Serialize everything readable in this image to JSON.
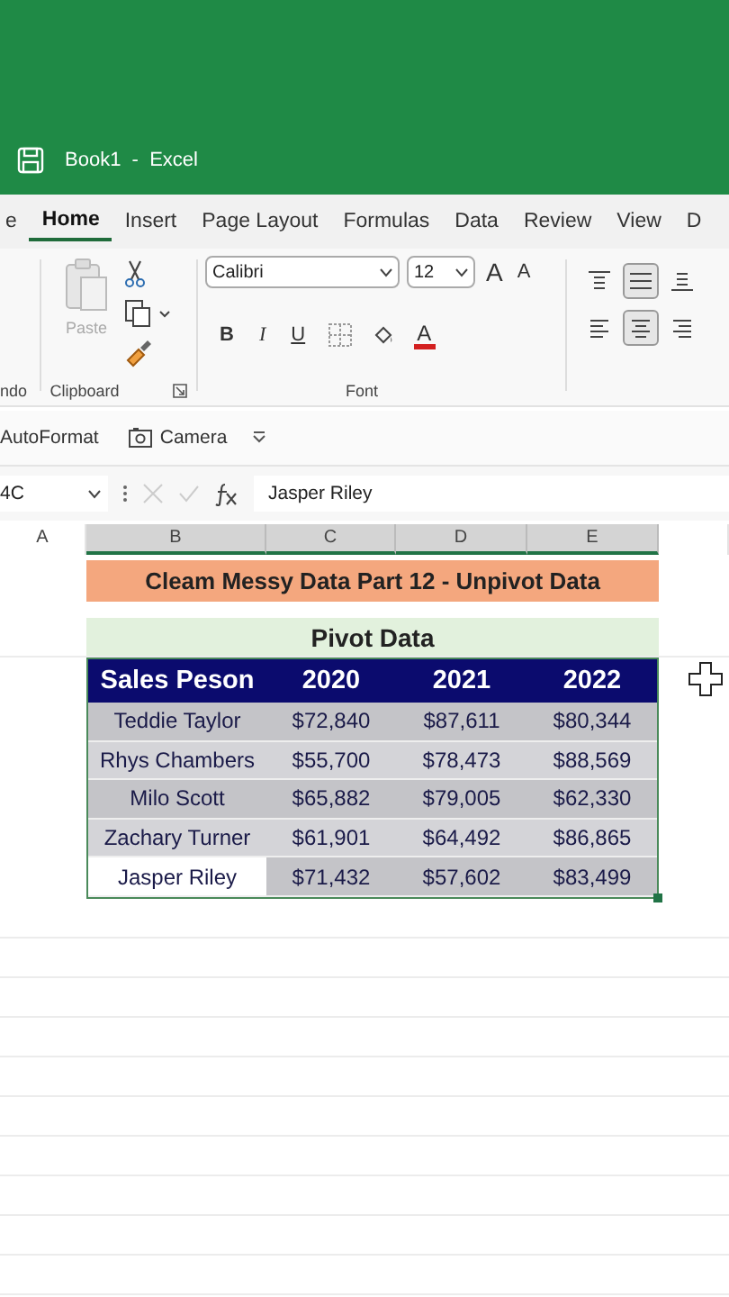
{
  "title_bar": {
    "title": "Book1  -  Excel"
  },
  "tabs": [
    {
      "label": "e",
      "selected": false
    },
    {
      "label": "Home",
      "selected": true
    },
    {
      "label": "Insert",
      "selected": false
    },
    {
      "label": "Page Layout",
      "selected": false
    },
    {
      "label": "Formulas",
      "selected": false
    },
    {
      "label": "Data",
      "selected": false
    },
    {
      "label": "Review",
      "selected": false
    },
    {
      "label": "View",
      "selected": false
    },
    {
      "label": "D",
      "selected": false
    }
  ],
  "ribbon": {
    "undo_group_label": "ndo",
    "paste_label": "Paste",
    "clipboard_label": "Clipboard",
    "font_name": "Calibri",
    "font_size": "12",
    "grow_font": "A",
    "shrink_font": "A",
    "bold": "B",
    "italic": "I",
    "underline": "U",
    "font_color": "A",
    "font_label": "Font",
    "vertical_align": [
      {
        "selected": false
      },
      {
        "selected": true
      },
      {
        "selected": false
      }
    ],
    "horizontal_align": [
      {
        "selected": false
      },
      {
        "selected": true
      },
      {
        "selected": false
      }
    ]
  },
  "quick_toolbar": [
    {
      "kind": "text",
      "label": "AutoFormat"
    },
    {
      "kind": "camera",
      "label": "Camera"
    }
  ],
  "formula_bar": {
    "name_box": "4C",
    "formula": "Jasper Riley"
  },
  "columns": [
    "A",
    "B",
    "C",
    "D",
    "E"
  ],
  "sheet": {
    "title": "Cleam Messy Data Part 12 - Unpivot Data",
    "subtitle": "Pivot Data",
    "headers": [
      "Sales Peson",
      "2020",
      "2021",
      "2022"
    ],
    "rows": [
      {
        "cells": [
          "Teddie Taylor",
          "$72,840",
          "$87,611",
          "$80,344"
        ],
        "selected": false
      },
      {
        "cells": [
          "Rhys Chambers",
          "$55,700",
          "$78,473",
          "$88,569"
        ],
        "selected": false
      },
      {
        "cells": [
          "Milo Scott",
          "$65,882",
          "$79,005",
          "$62,330"
        ],
        "selected": false
      },
      {
        "cells": [
          "Zachary Turner",
          "$61,901",
          "$64,492",
          "$86,865"
        ],
        "selected": false
      },
      {
        "cells": [
          "Jasper Riley",
          "$71,432",
          "$57,602",
          "$83,499"
        ],
        "selected": true
      }
    ]
  }
}
